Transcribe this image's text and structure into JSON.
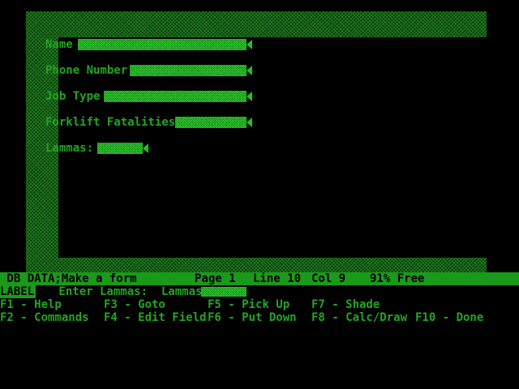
{
  "form": {
    "fields": [
      {
        "label": "Name"
      },
      {
        "label": "Phone Number"
      },
      {
        "label": "Job Type"
      },
      {
        "label": "Forklift Fatalities"
      },
      {
        "label": "Lammas:"
      }
    ]
  },
  "status": {
    "mode": " DB DATA;Make a form",
    "page": "Page 1",
    "line": "Line 10",
    "col": "Col 9",
    "free": "91% Free"
  },
  "prompt": {
    "label": "LABEL",
    "text": " Enter Lammas:  Lammas='"
  },
  "function_keys": [
    {
      "key": "F1 - Help"
    },
    {
      "key": "F2 - Commands"
    },
    {
      "key": "F3 - Goto"
    },
    {
      "key": "F4 - Edit Field"
    },
    {
      "key": "F5 - Pick Up"
    },
    {
      "key": "F6 - Put Down"
    },
    {
      "key": "F7 - Shade"
    },
    {
      "key": "F8 - Calc/Draw"
    },
    {
      "key": "F10 - Done"
    }
  ]
}
